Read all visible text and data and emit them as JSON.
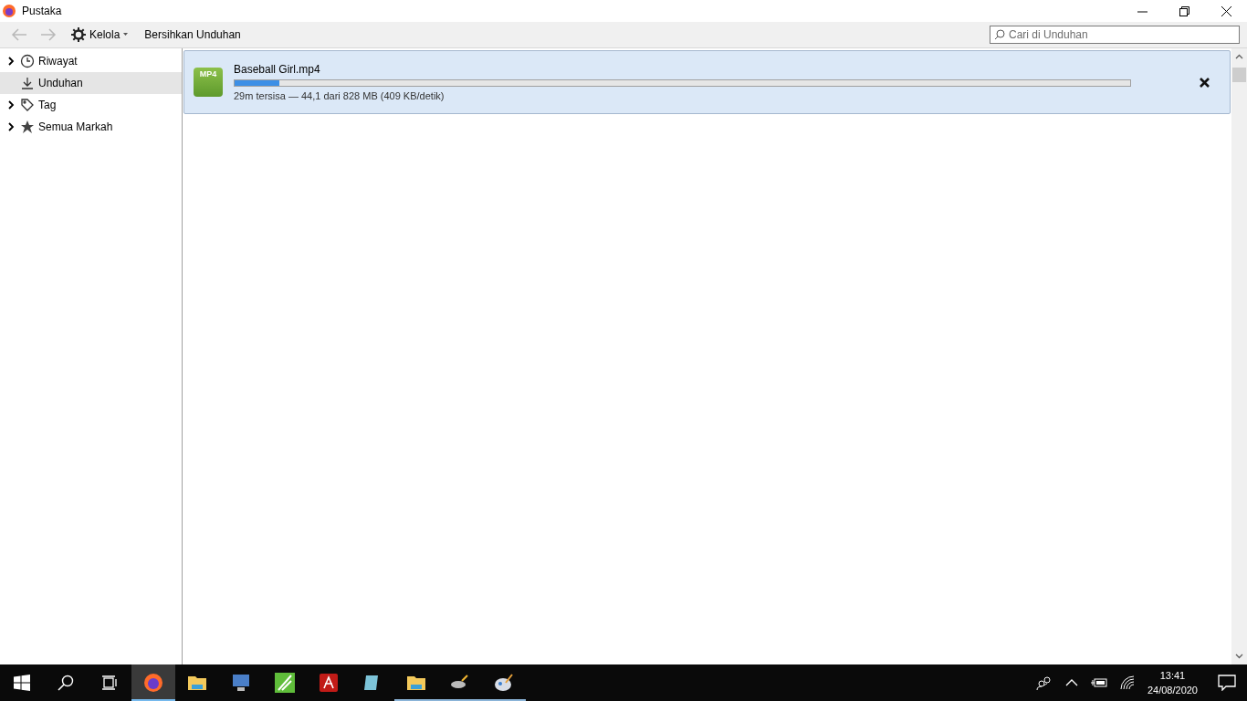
{
  "window": {
    "title": "Pustaka"
  },
  "toolbar": {
    "manage": "Kelola",
    "clear": "Bersihkan Unduhan",
    "search": {
      "placeholder": "Cari di Unduhan"
    }
  },
  "sidebar": {
    "items": [
      {
        "label": "Riwayat",
        "kind": "group",
        "expanded": false,
        "selected": false
      },
      {
        "label": "Unduhan",
        "kind": "item",
        "selected": true
      },
      {
        "label": "Tag",
        "kind": "group",
        "expanded": false,
        "selected": false
      },
      {
        "label": "Semua Markah",
        "kind": "group",
        "expanded": false,
        "selected": false
      }
    ]
  },
  "downloads": [
    {
      "file_type": "MP4",
      "name": "Baseball Girl.mp4",
      "level": 0.05,
      "status": "29m tersisa — 44,1 dari 828 MB (409 KB/detik)",
      "selected": true
    }
  ],
  "taskbar": {
    "apps": [
      {
        "selected": true,
        "running": true
      },
      {
        "selected": false,
        "running": false
      },
      {
        "selected": false,
        "running": false
      },
      {
        "selected": false,
        "running": false
      },
      {
        "selected": false,
        "running": false
      },
      {
        "selected": false,
        "running": false
      },
      {
        "selected": false,
        "running": true
      },
      {
        "selected": false,
        "running": true
      },
      {
        "selected": false,
        "running": true
      }
    ],
    "time": "13:41",
    "date": "24/08/2020"
  }
}
